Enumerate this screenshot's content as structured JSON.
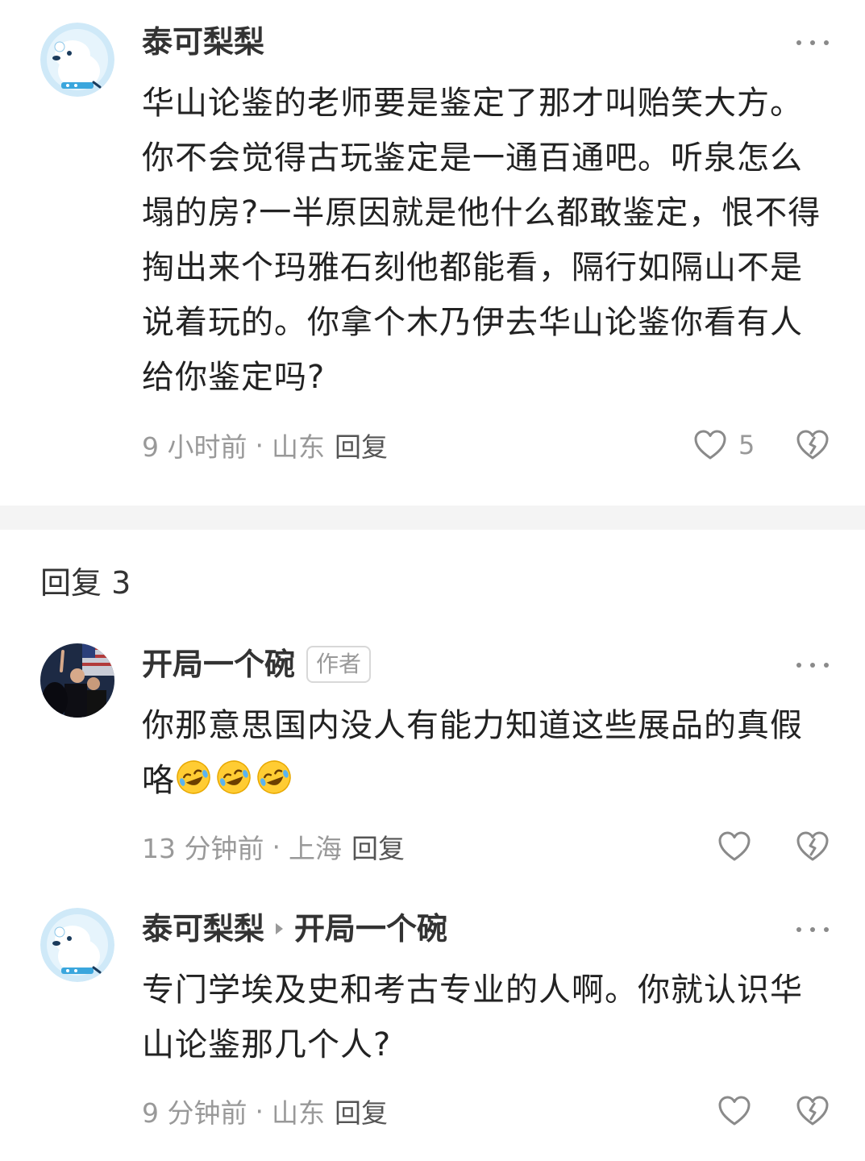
{
  "main_comment": {
    "username": "泰可梨梨",
    "text": "华山论鉴的老师要是鉴定了那才叫贻笑大方。你不会觉得古玩鉴定是一通百通吧。听泉怎么塌的房?一半原因就是他什么都敢鉴定，恨不得掏出来个玛雅石刻他都能看，隔行如隔山不是说着玩的。你拿个木乃伊去华山论鉴你看有人给你鉴定吗?",
    "time": "9 小时前",
    "location": "山东",
    "reply_label": "回复",
    "like_count": "5"
  },
  "replies_header": "回复 3",
  "replies": [
    {
      "username": "开局一个碗",
      "author_tag": "作者",
      "text": "你那意思国内没人有能力知道这些展品的真假咯",
      "emojis": [
        "rofl-emoji",
        "rofl-emoji",
        "rofl-emoji"
      ],
      "time": "13 分钟前",
      "location": "上海",
      "reply_label": "回复"
    },
    {
      "username": "泰可梨梨",
      "reply_to": "开局一个碗",
      "text": "专门学埃及史和考古专业的人啊。你就认识华山论鉴那几个人?",
      "time": "9 分钟前",
      "location": "山东",
      "reply_label": "回复"
    }
  ],
  "separator": "·",
  "colors": {
    "text": "#222222",
    "meta": "#999999",
    "divider": "#f4f4f4",
    "avatar_bg": "#cfe9f8"
  }
}
